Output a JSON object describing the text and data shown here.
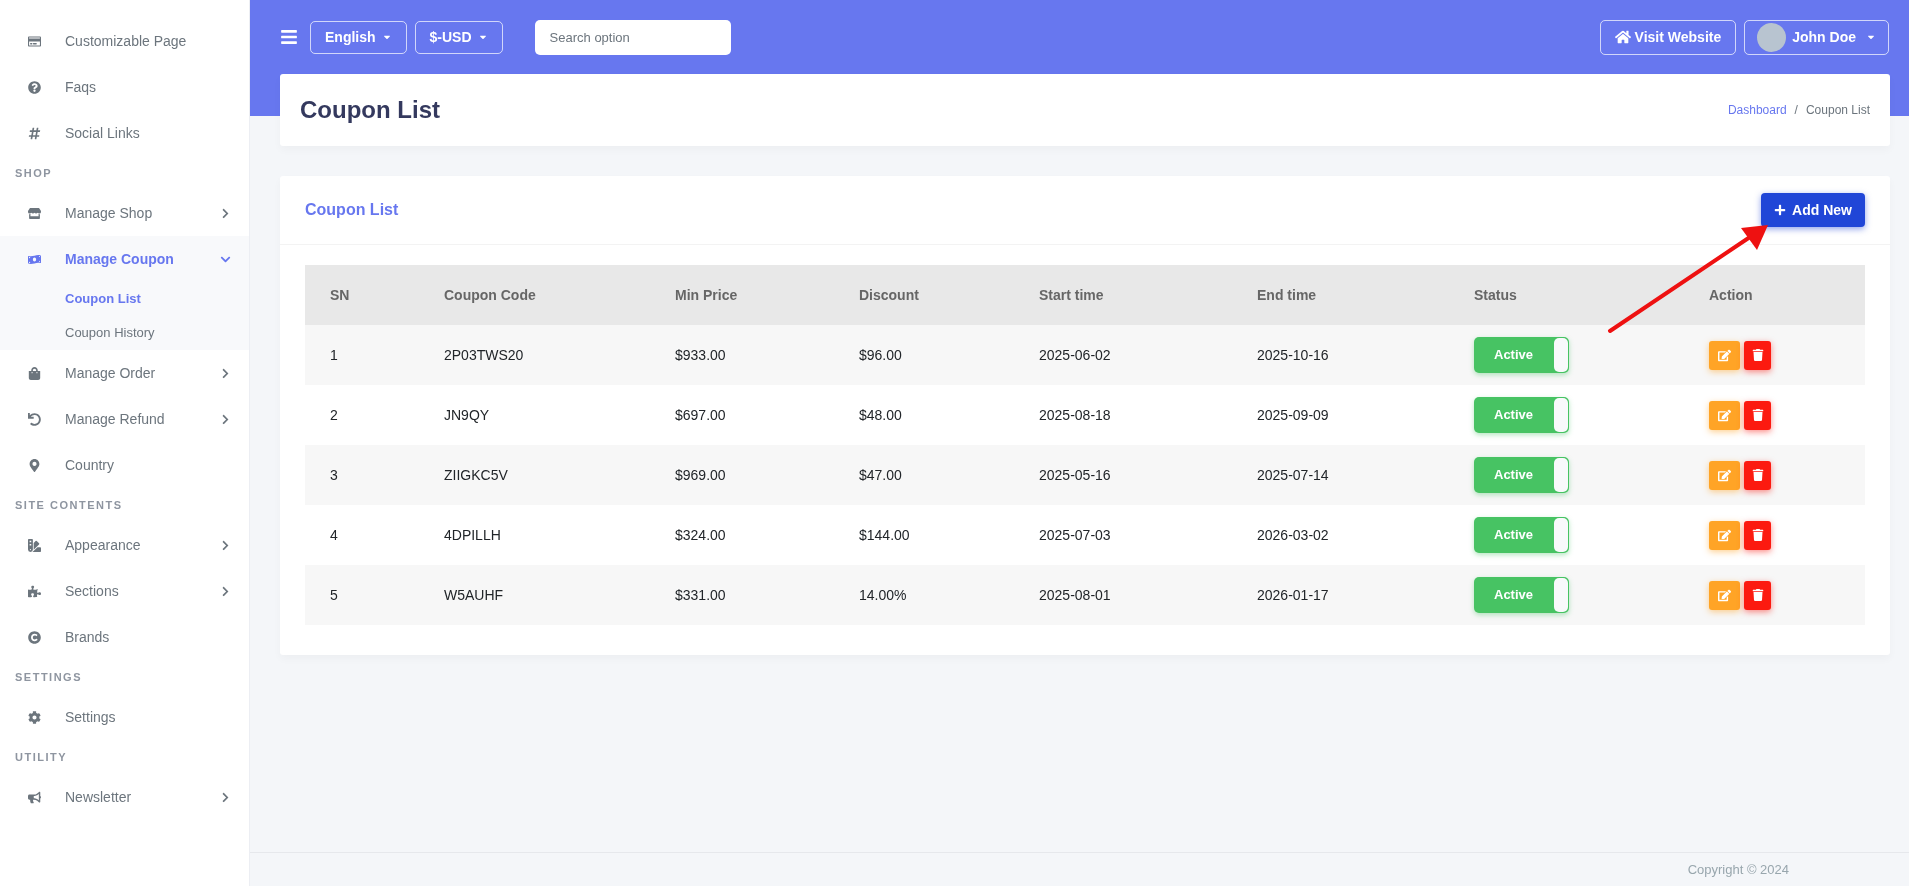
{
  "sidebar": {
    "entries": [
      {
        "kind": "link",
        "label": "Customizable Page",
        "selected": false
      },
      {
        "kind": "link",
        "label": "Faqs",
        "selected": false
      },
      {
        "kind": "link",
        "label": "Social Links",
        "selected": false
      },
      {
        "kind": "heading",
        "label": "SHOP"
      },
      {
        "kind": "link",
        "label": "Manage Shop",
        "selected": false,
        "expanded": false
      },
      {
        "kind": "link",
        "label": "Manage Coupon",
        "selected": true,
        "expanded": true,
        "children": [
          {
            "label": "Coupon List",
            "selected": true
          },
          {
            "label": "Coupon History",
            "selected": false
          }
        ]
      },
      {
        "kind": "link",
        "label": "Manage Order",
        "selected": false,
        "expanded": false
      },
      {
        "kind": "link",
        "label": "Manage Refund",
        "selected": false,
        "expanded": false
      },
      {
        "kind": "link",
        "label": "Country",
        "selected": false
      },
      {
        "kind": "heading",
        "label": "SITE CONTENTS"
      },
      {
        "kind": "link",
        "label": "Appearance",
        "selected": false,
        "expanded": false
      },
      {
        "kind": "link",
        "label": "Sections",
        "selected": false,
        "expanded": false
      },
      {
        "kind": "link",
        "label": "Brands",
        "selected": false
      },
      {
        "kind": "heading",
        "label": "SETTINGS"
      },
      {
        "kind": "link",
        "label": "Settings",
        "selected": false
      },
      {
        "kind": "heading",
        "label": "UTILITY"
      },
      {
        "kind": "link",
        "label": "Newsletter",
        "selected": false,
        "expanded": false
      }
    ]
  },
  "topbar": {
    "language": "English",
    "currency": "$-USD",
    "search": {
      "placeholder": "Search option"
    },
    "visit_button": "Visit Website",
    "user": "John Doe"
  },
  "page_header": {
    "title": "Coupon List",
    "breadcrumb": {
      "items": [
        "Dashboard",
        "Coupon List"
      ],
      "separator": "/"
    }
  },
  "card": {
    "title": "Coupon List",
    "add_button": "Add New",
    "table": {
      "columns": [
        "SN",
        "Coupon Code",
        "Min Price",
        "Discount",
        "Start time",
        "End time",
        "Status",
        "Action"
      ],
      "rows": [
        {
          "cells": [
            "1",
            "2P03TWS20",
            "$933.00",
            "$96.00",
            "2025-06-02",
            "2025-10-16"
          ],
          "status": {
            "label": "Active",
            "on": true
          }
        },
        {
          "cells": [
            "2",
            "JN9QY",
            "$697.00",
            "$48.00",
            "2025-08-18",
            "2025-09-09"
          ],
          "status": {
            "label": "Active",
            "on": true
          }
        },
        {
          "cells": [
            "3",
            "ZIIGKC5V",
            "$969.00",
            "$47.00",
            "2025-05-16",
            "2025-07-14"
          ],
          "status": {
            "label": "Active",
            "on": true
          }
        },
        {
          "cells": [
            "4",
            "4DPILLH",
            "$324.00",
            "$144.00",
            "2025-07-03",
            "2026-03-02"
          ],
          "status": {
            "label": "Active",
            "on": true
          }
        },
        {
          "cells": [
            "5",
            "W5AUHF",
            "$331.00",
            "14.00%",
            "2025-08-01",
            "2026-01-17"
          ],
          "status": {
            "label": "Active",
            "on": true
          }
        }
      ]
    }
  },
  "footer": {
    "copyright": "Copyright © 2024"
  }
}
